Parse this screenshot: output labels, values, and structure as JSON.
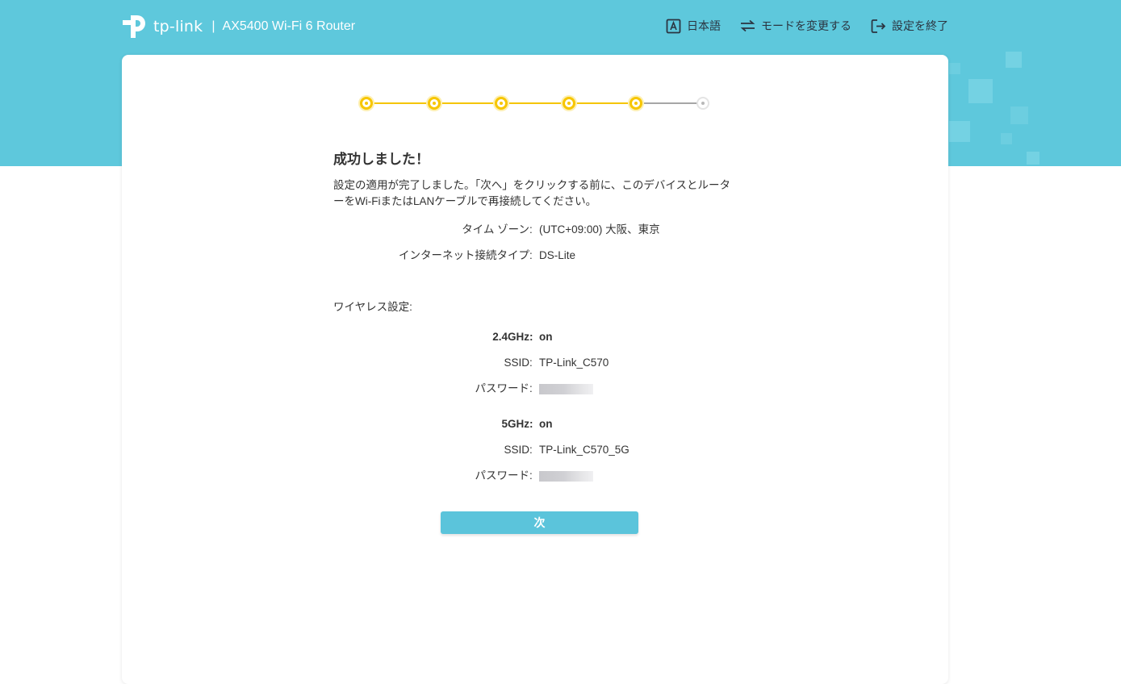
{
  "header": {
    "logo_text": "tp-link",
    "separator": "|",
    "product": "AX5400 Wi-Fi 6 Router",
    "nav": {
      "language": "日本語",
      "change_mode": "モードを変更する",
      "exit_setup": "設定を終了"
    }
  },
  "stepper": {
    "total_steps": 6,
    "completed_steps": 5
  },
  "result": {
    "title": "成功しました！",
    "description": "設定の適用が完了しました。「次へ」をクリックする前に、このデバイスとルーターをWi-FiまたはLANケーブルで再接続してください。"
  },
  "summary": {
    "time_zone_label": "タイム ゾーン",
    "time_zone_value": "(UTC+09:00) 大阪、東京",
    "internet_type_label": "インターネット接続タイプ",
    "internet_type_value": "DS-Lite",
    "colon": ":"
  },
  "wireless": {
    "section_label": "ワイヤレス設定:",
    "bands": [
      {
        "label": "2.4GHz",
        "status": "on",
        "ssid_label": "SSID",
        "ssid": "TP-Link_C570",
        "password_label": "パスワード"
      },
      {
        "label": "5GHz",
        "status": "on",
        "ssid_label": "SSID",
        "ssid": "TP-Link_C570_5G",
        "password_label": "パスワード"
      }
    ]
  },
  "buttons": {
    "next": "次"
  },
  "colors": {
    "banner": "#5ec8dc",
    "accent": "#5bc4db",
    "step_done": "#f7c600",
    "step_todo": "#a6a6a6"
  }
}
